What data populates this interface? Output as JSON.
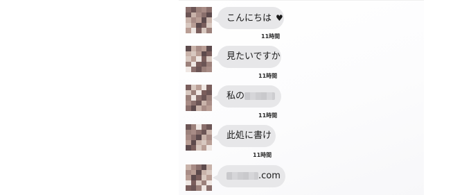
{
  "messages": [
    {
      "text": "こんにちは",
      "icon": "heart-icon",
      "icon_glyph": "♥",
      "time": "11時間"
    },
    {
      "text": "見たいですか",
      "time": "11時間"
    },
    {
      "text_prefix": "私の",
      "redacted": true,
      "time": "11時間"
    },
    {
      "text": "此処に書け",
      "time": "11時間"
    },
    {
      "redacted": true,
      "text_suffix": ".com"
    }
  ]
}
